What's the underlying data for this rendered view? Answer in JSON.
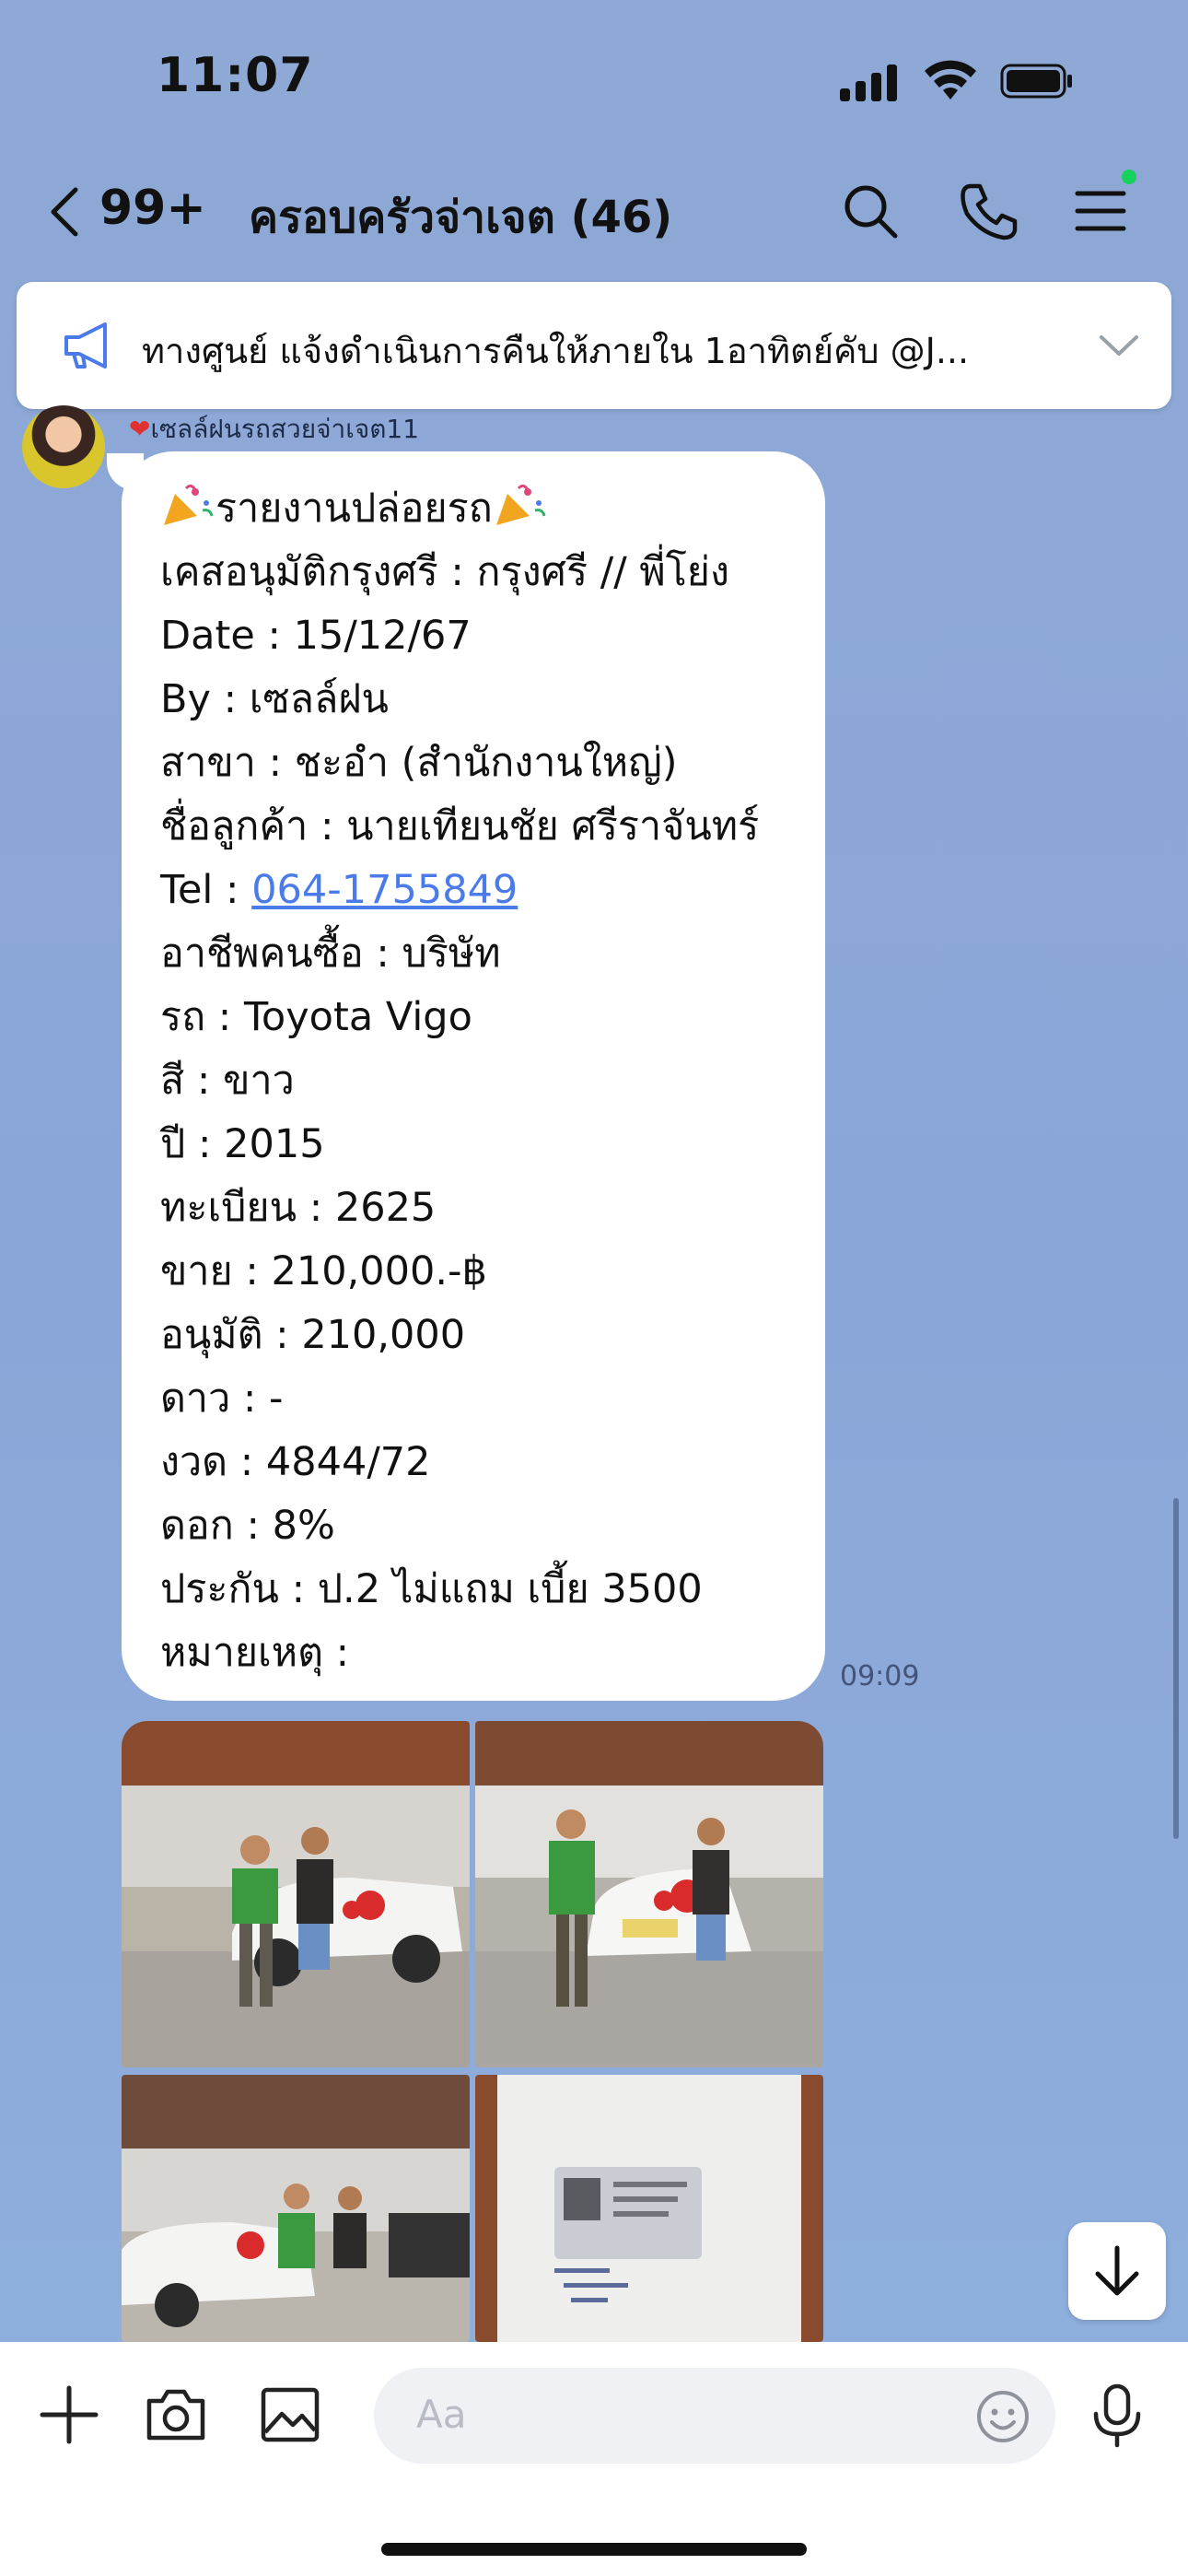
{
  "status": {
    "time": "11:07"
  },
  "header": {
    "unread_count": "99+",
    "title": "ครอบครัวจ่าเจต (46)",
    "online_dot_color": "#17d15d"
  },
  "announcement": {
    "text": "ทางศูนย์ แจ้งดำเนินการคืนให้ภายใน 1อาทิตย์คับ @J..."
  },
  "message": {
    "sender": "เซลล์ฝนรถสวยจ่าเจต11",
    "title": "รายงานปล่อยรถ",
    "lines": [
      "เคสอนุมัติกรุงศรี :  กรุงศรี // พี่โย่ง",
      "Date : 15/12/67",
      "By : เซลล์ฝน",
      "สาขา : ชะอำ (สำนักงานใหญ่)",
      "ชื่อลูกค้า : นายเทียนชัย ศรีราจันทร์"
    ],
    "tel_label": "Tel : ",
    "tel_number": "064-1755849",
    "lines_after": [
      "อาชีพคนซื้อ : บริษัท",
      "รถ : Toyota Vigo",
      "สี : ขาว",
      "ปี : 2015",
      "ทะเบียน : 2625",
      "ขาย : 210,000.-฿",
      "อนุมัติ : 210,000",
      "ดาว : -",
      "งวด : 4844/72",
      "ดอก : 8%",
      "ประกัน : ป.2 ไม่แถม เบี้ย 3500",
      "หมายเหตุ :"
    ],
    "time": "09:09",
    "link_color": "#4a7be8"
  },
  "composer": {
    "placeholder": "Aa"
  }
}
